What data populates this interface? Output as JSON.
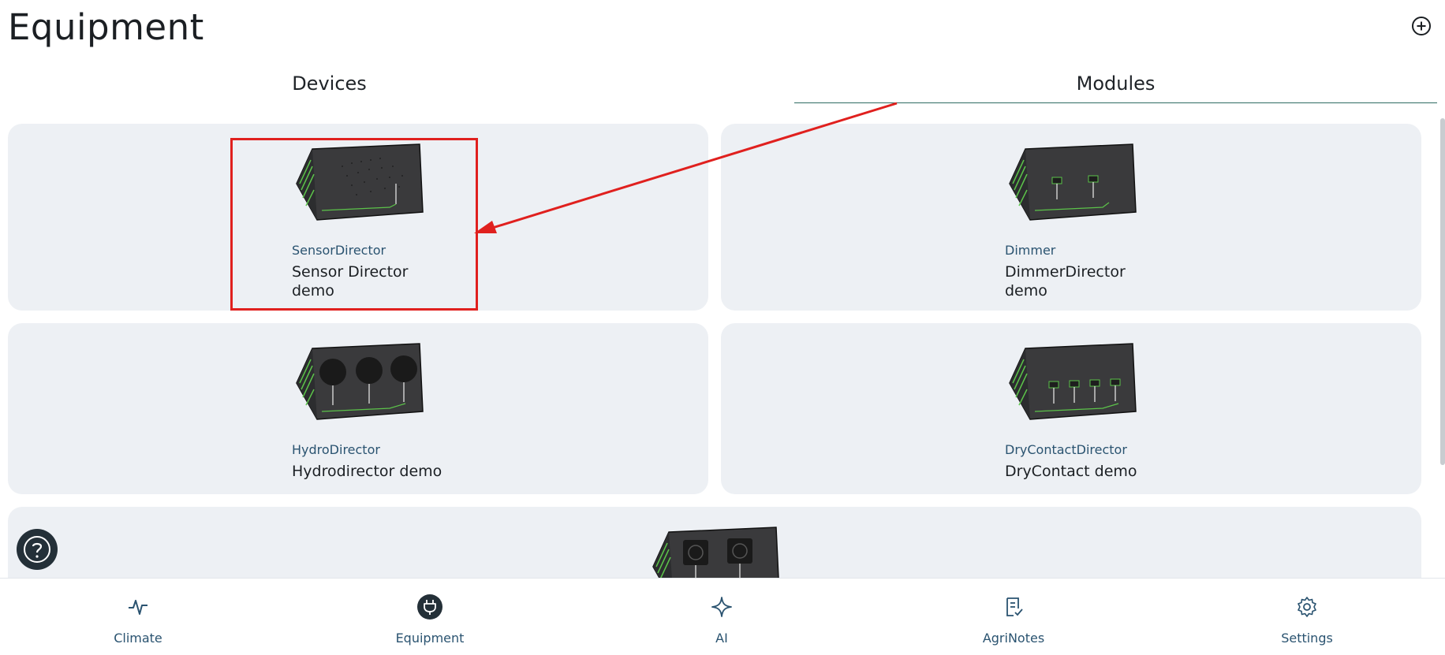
{
  "page": {
    "title": "Equipment"
  },
  "tabs": [
    {
      "label": "Devices"
    },
    {
      "label": "Modules"
    }
  ],
  "cards": [
    {
      "type": "SensorDirector",
      "name_line1": "Sensor Director",
      "name_line2": "demo",
      "icon": "sensor-director-device-image"
    },
    {
      "type": "Dimmer",
      "name_line1": "DimmerDirector",
      "name_line2": "demo",
      "icon": "dimmer-director-device-image"
    },
    {
      "type": "HydroDirector",
      "name_line1": "Hydrodirector demo",
      "icon": "hydro-director-device-image"
    },
    {
      "type": "DryContactDirector",
      "name_line1": "DryContact demo",
      "icon": "drycontact-director-device-image"
    },
    {
      "icon": "socket-director-device-image"
    }
  ],
  "nav": [
    {
      "label": "Climate",
      "icon": "pulse-icon"
    },
    {
      "label": "Equipment",
      "icon": "plug-icon",
      "active": true
    },
    {
      "label": "AI",
      "icon": "sparkle-icon"
    },
    {
      "label": "AgriNotes",
      "icon": "notes-check-icon"
    },
    {
      "label": "Settings",
      "icon": "gear-icon"
    }
  ],
  "colors": {
    "accent": "#2f6b63",
    "nav_text": "#2a5370",
    "card_bg": "#edf0f4",
    "annotation_red": "#e0201e",
    "device_green": "#5cc34a"
  }
}
